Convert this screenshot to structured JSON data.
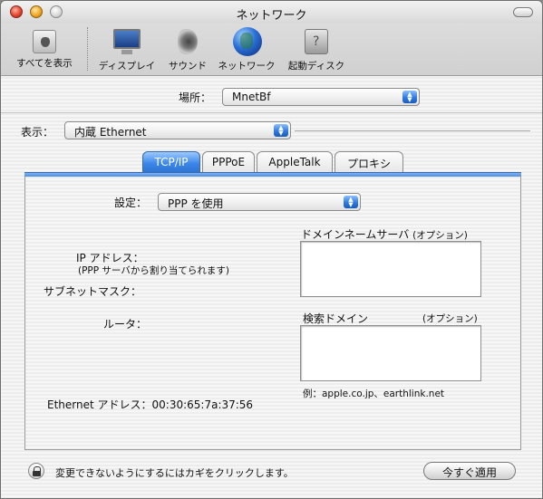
{
  "window": {
    "title": "ネットワーク"
  },
  "toolbar": {
    "items": [
      {
        "label": "すべてを表示",
        "icon": "show-all-icon"
      },
      {
        "label": "ディスプレイ",
        "icon": "display-icon"
      },
      {
        "label": "サウンド",
        "icon": "sound-icon"
      },
      {
        "label": "ネットワーク",
        "icon": "network-globe-icon"
      },
      {
        "label": "起動ディスク",
        "icon": "startup-disk-icon"
      }
    ]
  },
  "location": {
    "label": "場所：",
    "value": "MnetBf"
  },
  "show": {
    "label": "表示：",
    "value": "内蔵 Ethernet"
  },
  "tabs": [
    {
      "label": "TCP/IP",
      "active": true
    },
    {
      "label": "PPPoE",
      "active": false
    },
    {
      "label": "AppleTalk",
      "active": false
    },
    {
      "label": "プロキシ",
      "active": false
    }
  ],
  "tcpip": {
    "configure_label": "設定：",
    "configure_value": "PPP を使用",
    "ip_label": "IP アドレス：",
    "ip_note": "(PPP サーバから割り当てられます)",
    "subnet_label": "サブネットマスク：",
    "router_label": "ルータ：",
    "dns_label": "ドメインネームサーバ",
    "dns_optional": "(オプション)",
    "search_label": "検索ドメイン",
    "search_optional": "(オプション)",
    "example": "例：apple.co.jp、earthlink.net",
    "ethernet_label": "Ethernet アドレス：",
    "ethernet_value": "00:30:65:7a:37:56"
  },
  "footer": {
    "lock_text": "変更できないようにするにはカギをクリックします。",
    "apply_button": "今すぐ適用"
  },
  "colors": {
    "accent": "#3a86e8",
    "close": "#e2452f",
    "minimize": "#f0a823"
  }
}
